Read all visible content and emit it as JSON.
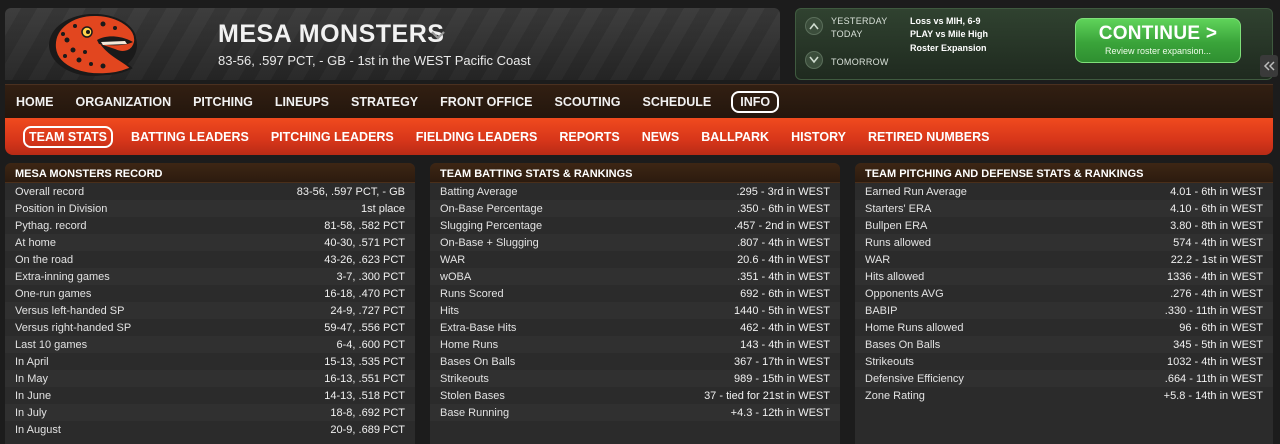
{
  "header": {
    "team_name": "MESA MONSTERS",
    "record_line": "83-56, .597 PCT, - GB - 1st in the WEST Pacific Coast"
  },
  "game_panel": {
    "yesterday_label": "YESTERDAY",
    "yesterday_value": "Loss vs MIH, 6-9",
    "today_label": "TODAY",
    "today_value": "PLAY vs Mile High",
    "today_extra": "Roster Expansion",
    "tomorrow_label": "TOMORROW",
    "continue_label": "CONTINUE",
    "continue_arrow": ">",
    "continue_sub": "Review roster expansion..."
  },
  "main_nav": [
    {
      "label": "HOME",
      "active": false
    },
    {
      "label": "ORGANIZATION",
      "active": false
    },
    {
      "label": "PITCHING",
      "active": false
    },
    {
      "label": "LINEUPS",
      "active": false
    },
    {
      "label": "STRATEGY",
      "active": false
    },
    {
      "label": "FRONT OFFICE",
      "active": false
    },
    {
      "label": "SCOUTING",
      "active": false
    },
    {
      "label": "SCHEDULE",
      "active": false
    },
    {
      "label": "INFO",
      "active": true
    }
  ],
  "sub_nav": [
    {
      "label": "TEAM STATS",
      "active": true
    },
    {
      "label": "BATTING LEADERS",
      "active": false
    },
    {
      "label": "PITCHING LEADERS",
      "active": false
    },
    {
      "label": "FIELDING LEADERS",
      "active": false
    },
    {
      "label": "REPORTS",
      "active": false
    },
    {
      "label": "NEWS",
      "active": false
    },
    {
      "label": "BALLPARK",
      "active": false
    },
    {
      "label": "HISTORY",
      "active": false
    },
    {
      "label": "RETIRED NUMBERS",
      "active": false
    }
  ],
  "record_panel": {
    "title": "MESA MONSTERS RECORD",
    "rows": [
      {
        "label": "Overall record",
        "value": "83-56, .597 PCT, - GB"
      },
      {
        "label": "Position in Division",
        "value": "1st place"
      },
      {
        "label": "Pythag. record",
        "value": "81-58, .582 PCT"
      },
      {
        "label": "At home",
        "value": "40-30, .571 PCT"
      },
      {
        "label": "On the road",
        "value": "43-26, .623 PCT"
      },
      {
        "label": "Extra-inning games",
        "value": "3-7, .300 PCT"
      },
      {
        "label": "One-run games",
        "value": "16-18, .470 PCT"
      },
      {
        "label": "Versus left-handed SP",
        "value": "24-9, .727 PCT"
      },
      {
        "label": "Versus right-handed SP",
        "value": "59-47, .556 PCT"
      },
      {
        "label": "Last 10 games",
        "value": "6-4, .600 PCT"
      },
      {
        "label": "In April",
        "value": "15-13, .535 PCT"
      },
      {
        "label": "In May",
        "value": "16-13, .551 PCT"
      },
      {
        "label": "In June",
        "value": "14-13, .518 PCT"
      },
      {
        "label": "In July",
        "value": "18-8, .692 PCT"
      },
      {
        "label": "In August",
        "value": "20-9, .689 PCT"
      }
    ]
  },
  "batting_panel": {
    "title": "TEAM BATTING STATS & RANKINGS",
    "rows": [
      {
        "label": "Batting Average",
        "value": ".295 - 3rd in WEST"
      },
      {
        "label": "On-Base Percentage",
        "value": ".350 - 6th in WEST"
      },
      {
        "label": "Slugging Percentage",
        "value": ".457 - 2nd in WEST"
      },
      {
        "label": "On-Base + Slugging",
        "value": ".807 - 4th in WEST"
      },
      {
        "label": "WAR",
        "value": "20.6 - 4th in WEST"
      },
      {
        "label": "wOBA",
        "value": ".351 - 4th in WEST"
      },
      {
        "label": "Runs Scored",
        "value": "692 - 6th in WEST"
      },
      {
        "label": "Hits",
        "value": "1440 - 5th in WEST"
      },
      {
        "label": "Extra-Base Hits",
        "value": "462 - 4th in WEST"
      },
      {
        "label": "Home Runs",
        "value": "143 - 4th in WEST"
      },
      {
        "label": "Bases On Balls",
        "value": "367 - 17th in WEST"
      },
      {
        "label": "Strikeouts",
        "value": "989 - 15th in WEST"
      },
      {
        "label": "Stolen Bases",
        "value": "37 - tied for 21st in WEST"
      },
      {
        "label": "Base Running",
        "value": "+4.3 - 12th in WEST"
      }
    ]
  },
  "pitching_panel": {
    "title": "TEAM PITCHING AND DEFENSE STATS & RANKINGS",
    "rows": [
      {
        "label": "Earned Run Average",
        "value": "4.01 - 6th in WEST"
      },
      {
        "label": "Starters' ERA",
        "value": "4.10 - 6th in WEST"
      },
      {
        "label": "Bullpen ERA",
        "value": "3.80 - 8th in WEST"
      },
      {
        "label": "Runs allowed",
        "value": "574 - 4th in WEST"
      },
      {
        "label": "WAR",
        "value": "22.2 - 1st in WEST"
      },
      {
        "label": "Hits allowed",
        "value": "1336 - 4th in WEST"
      },
      {
        "label": "Opponents AVG",
        "value": ".276 - 4th in WEST"
      },
      {
        "label": "BABIP",
        "value": ".330 - 11th in WEST"
      },
      {
        "label": "Home Runs allowed",
        "value": "96 - 6th in WEST"
      },
      {
        "label": "Bases On Balls",
        "value": "345 - 5th in WEST"
      },
      {
        "label": "Strikeouts",
        "value": "1032 - 4th in WEST"
      },
      {
        "label": "Defensive Efficiency",
        "value": ".664 - 11th in WEST"
      },
      {
        "label": "Zone Rating",
        "value": "+5.8 - 14th in WEST"
      }
    ]
  },
  "colors": {
    "accent_orange": "#e03e1a",
    "continue_green": "#3aa43a",
    "nav_dark": "#2a1a0f"
  },
  "icons": {
    "logo": "gila-monster-logo",
    "team_dropdown": "chevron-down-icon",
    "prev_day": "chevron-up-icon",
    "next_day": "chevron-down-icon",
    "collapse": "double-chevron-left-icon"
  }
}
